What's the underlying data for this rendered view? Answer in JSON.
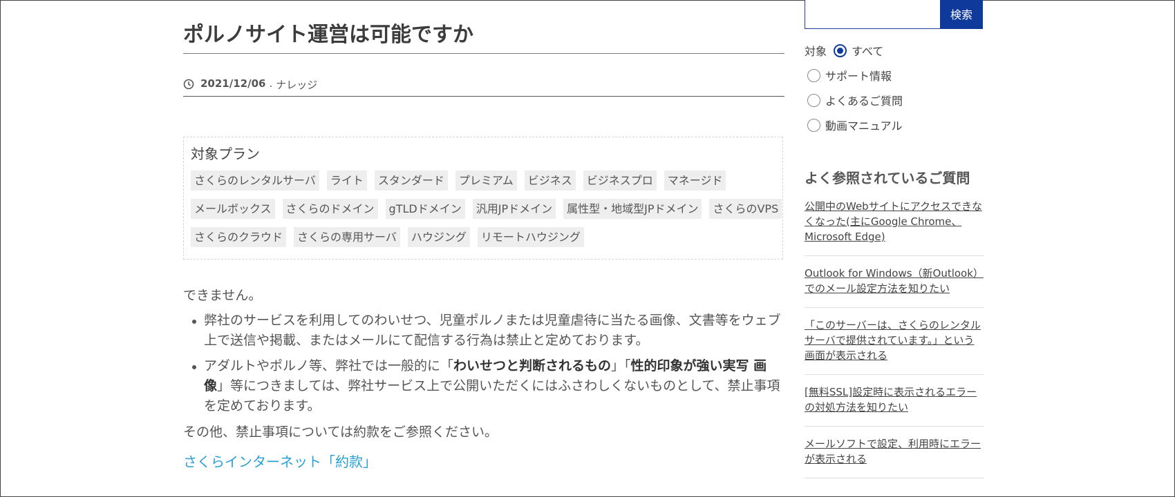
{
  "article": {
    "title": "ポルノサイト運営は可能ですか",
    "date": "2021/12/06",
    "separator": ".",
    "category": "ナレッジ"
  },
  "plans": {
    "label": "対象プラン",
    "rows": [
      [
        "さくらのレンタルサーバ",
        "ライト",
        "スタンダード",
        "プレミアム",
        "ビジネス",
        "ビジネスプロ",
        "マネージド"
      ],
      [
        "メールボックス",
        "さくらのドメイン",
        "gTLDドメイン",
        "汎用JPドメイン",
        "属性型・地域型JPドメイン",
        "さくらのVPS"
      ],
      [
        "さくらのクラウド",
        "さくらの専用サーバ",
        "ハウジング",
        "リモートハウジング"
      ]
    ]
  },
  "answer": {
    "lead": "できません。",
    "bullet1": "弊社のサービスを利用してのわいせつ、児童ポルノまたは児童虐待に当たる画像、文書等をウェブ上で送信や掲載、またはメールにて配信する行為は禁止と定めております。",
    "bullet2_prefix": "アダルトやポルノ等、弊社では一般的に「",
    "bullet2_bold1": "わいせつと判断されるもの",
    "bullet2_mid": "」「",
    "bullet2_bold2": "性的印象が強い実写 画像",
    "bullet2_suffix": "」等につきましては、弊社サービス上で公開いただくにはふさわしくないものとして、禁止事項を定めております。",
    "note": "その他、禁止事項については約款をご参照ください。",
    "link": "さくらインターネット「約款」"
  },
  "search": {
    "placeholder": "",
    "button": "検索",
    "target_label": "対象",
    "options": [
      "すべて",
      "サポート情報",
      "よくあるご質問",
      "動画マニュアル"
    ],
    "selected": "すべて"
  },
  "faq": {
    "title": "よく参照されているご質問",
    "items": [
      "公開中のWebサイトにアクセスできなくなった(主にGoogle Chrome、Microsoft Edge)",
      "Outlook for Windows（新Outlook）でのメール設定方法を知りたい",
      "「このサーバーは、さくらのレンタルサーバで提供されています。」という画面が表示される",
      "[無料SSL]設定時に表示されるエラーの対処方法を知りたい",
      "メールソフトで設定、利用時にエラーが表示される"
    ]
  },
  "colors": {
    "accent": "#0f3a9c",
    "link": "#2aa0d6",
    "tag_bg": "#eeeeee"
  }
}
